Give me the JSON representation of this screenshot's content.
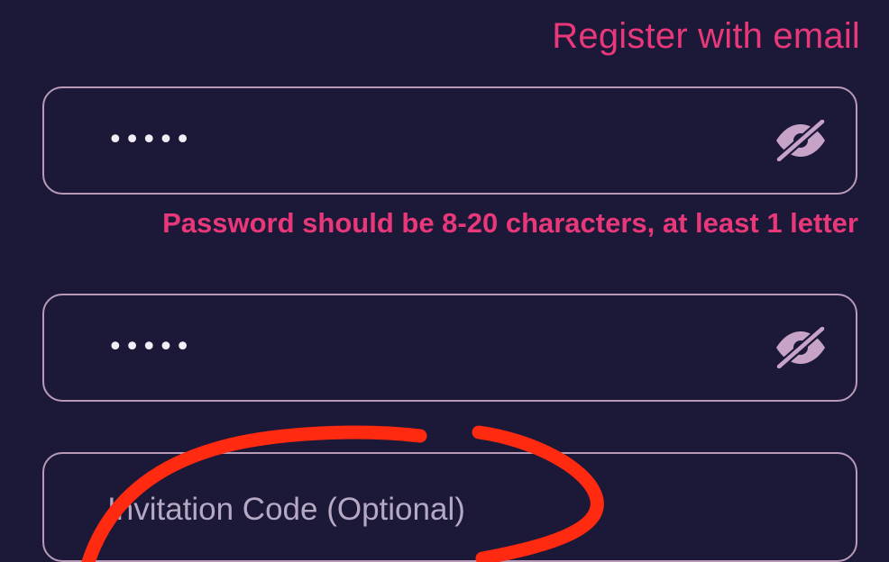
{
  "header": {
    "register_email_label": "Register with email"
  },
  "password_field": {
    "masked_value": "•••••",
    "toggle_icon": "eye-slash-icon",
    "hint": "Password should be 8-20 characters, at least 1 letter"
  },
  "confirm_password_field": {
    "masked_value": "•••••",
    "toggle_icon": "eye-slash-icon"
  },
  "invitation_field": {
    "placeholder": "Invitation Code (Optional)",
    "value": ""
  },
  "colors": {
    "background": "#1c1838",
    "accent": "#e8387a",
    "field_border": "#b89bb8",
    "icon": "#c7a3c7",
    "annotation_stroke": "#ff2a10"
  }
}
